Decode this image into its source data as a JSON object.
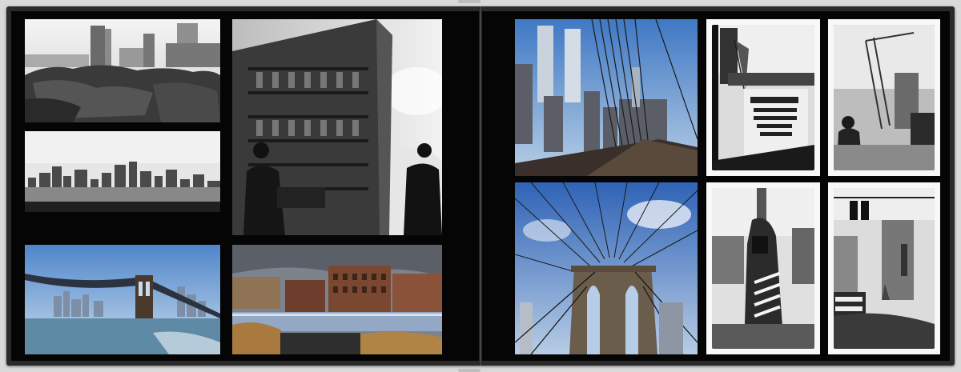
{
  "book": {
    "pages": [
      {
        "side": "left",
        "photos": [
          {
            "name": "photo-skyline-rocks",
            "subject": "rocks-and-skyline-bw"
          },
          {
            "name": "photo-flatiron-building",
            "subject": "flatiron-building-bw"
          },
          {
            "name": "photo-manhattan-skyline-bw",
            "subject": "skyline-bw"
          },
          {
            "name": "photo-brooklyn-bridge-color",
            "subject": "brooklyn-bridge-color"
          },
          {
            "name": "photo-brick-buildings-water",
            "subject": "brick-buildings-color"
          }
        ]
      },
      {
        "side": "right",
        "photos": [
          {
            "name": "photo-twin-towers",
            "subject": "twin-towers-bridge-cables"
          },
          {
            "name": "photo-bridge-tower-cables",
            "subject": "brooklyn-bridge-tower"
          },
          {
            "name": "polaroid-memorial-sign",
            "subject": "memorial-sign-bw"
          },
          {
            "name": "polaroid-crane-scene",
            "subject": "crane-scene-bw"
          },
          {
            "name": "polaroid-flag-person",
            "subject": "flag-person-bw"
          },
          {
            "name": "polaroid-traffic-light-flags",
            "subject": "traffic-light-flags-bw"
          }
        ]
      }
    ]
  }
}
